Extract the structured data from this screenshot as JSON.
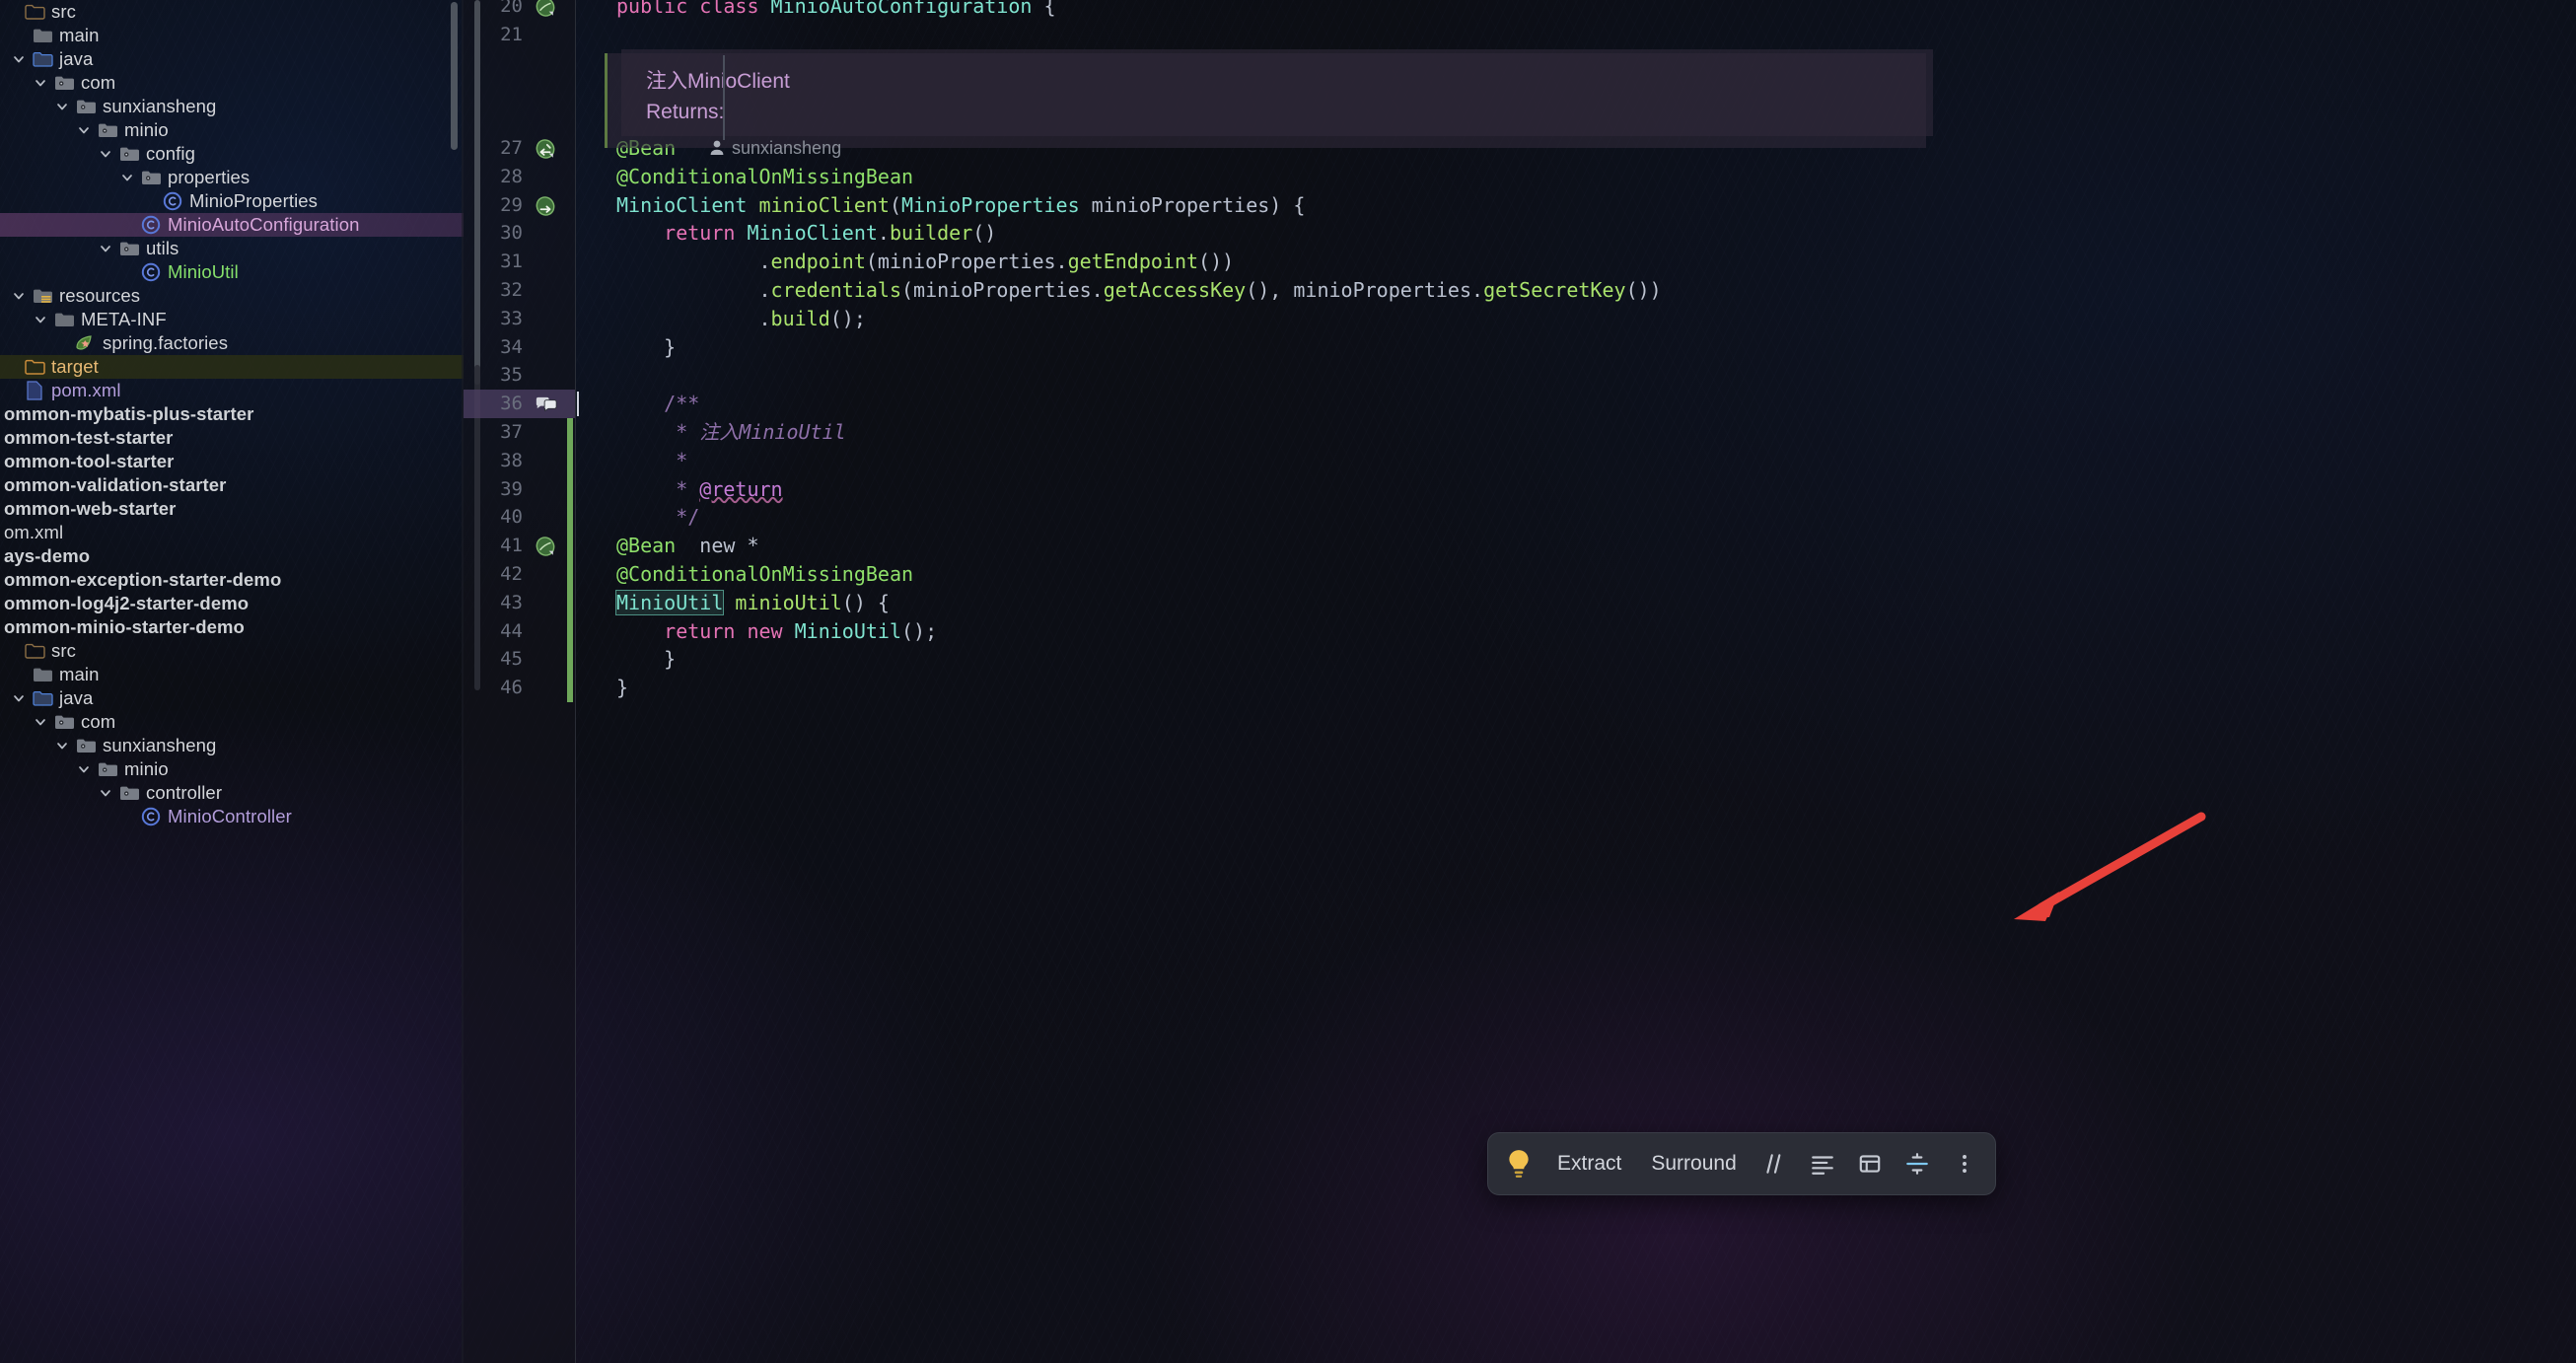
{
  "app": {
    "theme_bg": "#0d0f14",
    "accent_selection": "#5c3a66",
    "arrow_color": "#e8413a"
  },
  "sidebar": {
    "name": "project-tree",
    "items": [
      {
        "label": "src",
        "depth": 0,
        "icon": "folder-src",
        "chevron": "none",
        "style": "plain",
        "selected": false
      },
      {
        "label": "main",
        "depth": 1,
        "icon": "folder",
        "chevron": "none",
        "style": "plain",
        "selected": false
      },
      {
        "label": "java",
        "depth": 1,
        "icon": "folder-source",
        "chevron": "down",
        "style": "plain",
        "selected": false
      },
      {
        "label": "com",
        "depth": 2,
        "icon": "folder-package",
        "chevron": "down",
        "style": "plain",
        "selected": false
      },
      {
        "label": "sunxiansheng",
        "depth": 3,
        "icon": "folder-package",
        "chevron": "down",
        "style": "plain",
        "selected": false
      },
      {
        "label": "minio",
        "depth": 4,
        "icon": "folder-package",
        "chevron": "down",
        "style": "plain",
        "selected": false
      },
      {
        "label": "config",
        "depth": 5,
        "icon": "folder-package",
        "chevron": "down",
        "style": "plain",
        "selected": false
      },
      {
        "label": "properties",
        "depth": 6,
        "icon": "folder-package",
        "chevron": "down",
        "style": "plain",
        "selected": false
      },
      {
        "label": "MinioProperties",
        "depth": 7,
        "icon": "java-class",
        "chevron": "none",
        "style": "plain",
        "selected": false
      },
      {
        "label": "MinioAutoConfiguration",
        "depth": 6,
        "icon": "java-class",
        "chevron": "none",
        "style": "purple",
        "selected": true
      },
      {
        "label": "utils",
        "depth": 5,
        "icon": "folder-package",
        "chevron": "down",
        "style": "plain",
        "selected": false
      },
      {
        "label": "MinioUtil",
        "depth": 6,
        "icon": "java-class",
        "chevron": "none",
        "style": "green",
        "selected": false
      },
      {
        "label": "resources",
        "depth": 1,
        "icon": "folder-resource",
        "chevron": "down",
        "style": "plain",
        "selected": false
      },
      {
        "label": "META-INF",
        "depth": 2,
        "icon": "folder",
        "chevron": "down",
        "style": "plain",
        "selected": false
      },
      {
        "label": "spring.factories",
        "depth": 3,
        "icon": "spring-leaf",
        "chevron": "none",
        "style": "plain",
        "selected": false
      },
      {
        "label": "target",
        "depth": 0,
        "icon": "folder-excluded",
        "chevron": "none",
        "style": "orange",
        "selected": false,
        "highlight": "target"
      },
      {
        "label": "pom.xml",
        "depth": 0,
        "icon": "maven-file",
        "chevron": "none",
        "style": "lilac",
        "selected": false
      },
      {
        "label": "ommon-mybatis-plus-starter",
        "depth": 0,
        "icon": "none",
        "chevron": "none",
        "style": "bold",
        "selected": false
      },
      {
        "label": "ommon-test-starter",
        "depth": 0,
        "icon": "none",
        "chevron": "none",
        "style": "bold",
        "selected": false
      },
      {
        "label": "ommon-tool-starter",
        "depth": 0,
        "icon": "none",
        "chevron": "none",
        "style": "bold",
        "selected": false
      },
      {
        "label": "ommon-validation-starter",
        "depth": 0,
        "icon": "none",
        "chevron": "none",
        "style": "bold",
        "selected": false
      },
      {
        "label": "ommon-web-starter",
        "depth": 0,
        "icon": "none",
        "chevron": "none",
        "style": "bold",
        "selected": false
      },
      {
        "label": "om.xml",
        "depth": 0,
        "icon": "none",
        "chevron": "none",
        "style": "plain",
        "selected": false
      },
      {
        "label": "ays-demo",
        "depth": 0,
        "icon": "none",
        "chevron": "none",
        "style": "bold",
        "selected": false
      },
      {
        "label": "ommon-exception-starter-demo",
        "depth": 0,
        "icon": "none",
        "chevron": "none",
        "style": "bold",
        "selected": false
      },
      {
        "label": "ommon-log4j2-starter-demo",
        "depth": 0,
        "icon": "none",
        "chevron": "none",
        "style": "bold",
        "selected": false
      },
      {
        "label": "ommon-minio-starter-demo",
        "depth": 0,
        "icon": "none",
        "chevron": "none",
        "style": "bold",
        "selected": false
      },
      {
        "label": "src",
        "depth": 0,
        "icon": "folder-src",
        "chevron": "none",
        "style": "plain",
        "selected": false
      },
      {
        "label": "main",
        "depth": 1,
        "icon": "folder",
        "chevron": "none",
        "style": "plain",
        "selected": false
      },
      {
        "label": "java",
        "depth": 1,
        "icon": "folder-source",
        "chevron": "down",
        "style": "plain",
        "selected": false
      },
      {
        "label": "com",
        "depth": 2,
        "icon": "folder-package",
        "chevron": "down",
        "style": "plain",
        "selected": false
      },
      {
        "label": "sunxiansheng",
        "depth": 3,
        "icon": "folder-package",
        "chevron": "down",
        "style": "plain",
        "selected": false
      },
      {
        "label": "minio",
        "depth": 4,
        "icon": "folder-package",
        "chevron": "down",
        "style": "plain",
        "selected": false
      },
      {
        "label": "controller",
        "depth": 5,
        "icon": "folder-package",
        "chevron": "down",
        "style": "plain",
        "selected": false
      },
      {
        "label": "MinioController",
        "depth": 6,
        "icon": "java-class",
        "chevron": "none",
        "style": "lilac",
        "selected": false
      }
    ]
  },
  "editor": {
    "name": "code-editor",
    "file": "MinioAutoConfiguration",
    "javadoc_panel": {
      "line1": "注入MinioClient",
      "line2": "Returns:"
    },
    "inlay_author": "sunxiansheng",
    "lines": [
      {
        "num": "20",
        "gutter_icon": "bean-class",
        "tokens": [
          {
            "t": "public ",
            "c": "kw"
          },
          {
            "t": "class ",
            "c": "kw"
          },
          {
            "t": "MinioAutoConfiguration",
            "c": "ty"
          },
          {
            "t": " {",
            "c": "pl"
          }
        ]
      },
      {
        "num": "21",
        "gutter_icon": "",
        "tokens": []
      },
      {
        "num": "",
        "gutter_icon": "",
        "tokens": []
      },
      {
        "num": "",
        "gutter_icon": "",
        "tokens": []
      },
      {
        "num": "",
        "gutter_icon": "",
        "tokens": []
      },
      {
        "num": "27",
        "gutter_icon": "bean-arrow-left",
        "tokens": [
          {
            "t": "@Bean",
            "c": "an"
          }
        ]
      },
      {
        "num": "28",
        "gutter_icon": "",
        "tokens": [
          {
            "t": "@ConditionalOnMissingBean",
            "c": "an"
          }
        ]
      },
      {
        "num": "29",
        "gutter_icon": "bean-arrow-right",
        "tokens": [
          {
            "t": "MinioClient",
            "c": "ty"
          },
          {
            "t": " ",
            "c": "pl"
          },
          {
            "t": "minioClient",
            "c": "fn"
          },
          {
            "t": "(",
            "c": "pl"
          },
          {
            "t": "MinioProperties",
            "c": "ty"
          },
          {
            "t": " ",
            "c": "pl"
          },
          {
            "t": "minioProperties",
            "c": "pm"
          },
          {
            "t": ") {",
            "c": "pl"
          }
        ]
      },
      {
        "num": "30",
        "gutter_icon": "",
        "tokens": [
          {
            "t": "    ",
            "c": "pl"
          },
          {
            "t": "return ",
            "c": "kw"
          },
          {
            "t": "MinioClient",
            "c": "ty"
          },
          {
            "t": ".",
            "c": "pl"
          },
          {
            "t": "builder",
            "c": "fn"
          },
          {
            "t": "()",
            "c": "pl"
          }
        ]
      },
      {
        "num": "31",
        "gutter_icon": "",
        "tokens": [
          {
            "t": "            .",
            "c": "pl"
          },
          {
            "t": "endpoint",
            "c": "fn"
          },
          {
            "t": "(",
            "c": "pl"
          },
          {
            "t": "minioProperties",
            "c": "pm"
          },
          {
            "t": ".",
            "c": "pl"
          },
          {
            "t": "getEndpoint",
            "c": "fn"
          },
          {
            "t": "())",
            "c": "pl"
          }
        ]
      },
      {
        "num": "32",
        "gutter_icon": "",
        "tokens": [
          {
            "t": "            .",
            "c": "pl"
          },
          {
            "t": "credentials",
            "c": "fn"
          },
          {
            "t": "(",
            "c": "pl"
          },
          {
            "t": "minioProperties",
            "c": "pm"
          },
          {
            "t": ".",
            "c": "pl"
          },
          {
            "t": "getAccessKey",
            "c": "fn"
          },
          {
            "t": "(), ",
            "c": "pl"
          },
          {
            "t": "minioProperties",
            "c": "pm"
          },
          {
            "t": ".",
            "c": "pl"
          },
          {
            "t": "getSecretKey",
            "c": "fn"
          },
          {
            "t": "())",
            "c": "pl"
          }
        ]
      },
      {
        "num": "33",
        "gutter_icon": "",
        "tokens": [
          {
            "t": "            .",
            "c": "pl"
          },
          {
            "t": "build",
            "c": "fn"
          },
          {
            "t": "();",
            "c": "pl"
          }
        ]
      },
      {
        "num": "34",
        "gutter_icon": "",
        "tokens": [
          {
            "t": "    }",
            "c": "pl"
          }
        ]
      },
      {
        "num": "35",
        "gutter_icon": "",
        "tokens": []
      },
      {
        "num": "36",
        "gutter_icon": "comment-bubble",
        "tokens": [
          {
            "t": "    /**",
            "c": "cm"
          }
        ]
      },
      {
        "num": "37",
        "gutter_icon": "",
        "tokens": [
          {
            "t": "     * ",
            "c": "cm"
          },
          {
            "t": "注入MinioUtil",
            "c": "cmi"
          }
        ]
      },
      {
        "num": "38",
        "gutter_icon": "",
        "tokens": [
          {
            "t": "     *",
            "c": "cm"
          }
        ]
      },
      {
        "num": "39",
        "gutter_icon": "",
        "tokens": [
          {
            "t": "     * ",
            "c": "cm"
          },
          {
            "t": "@return",
            "c": "tag"
          }
        ]
      },
      {
        "num": "40",
        "gutter_icon": "",
        "tokens": [
          {
            "t": "     */",
            "c": "cm"
          }
        ]
      },
      {
        "num": "41",
        "gutter_icon": "bean-class",
        "tokens": [
          {
            "t": "@Bean",
            "c": "an"
          },
          {
            "t": "  new *",
            "c": "pl"
          }
        ]
      },
      {
        "num": "42",
        "gutter_icon": "",
        "tokens": [
          {
            "t": "@ConditionalOnMissingBean",
            "c": "an"
          }
        ]
      },
      {
        "num": "43",
        "gutter_icon": "",
        "tokens": [
          {
            "t": "MinioUtil",
            "c": "ty hlbox"
          },
          {
            "t": " ",
            "c": "pl"
          },
          {
            "t": "minioUtil",
            "c": "fn"
          },
          {
            "t": "() {",
            "c": "pl"
          }
        ]
      },
      {
        "num": "44",
        "gutter_icon": "",
        "tokens": [
          {
            "t": "    ",
            "c": "pl"
          },
          {
            "t": "return ",
            "c": "kw"
          },
          {
            "t": "new ",
            "c": "kw"
          },
          {
            "t": "MinioUtil",
            "c": "ty"
          },
          {
            "t": "();",
            "c": "pl"
          }
        ]
      },
      {
        "num": "45",
        "gutter_icon": "",
        "tokens": [
          {
            "t": "    }",
            "c": "pl"
          }
        ]
      },
      {
        "num": "46",
        "gutter_icon": "",
        "tokens": [
          {
            "t": "}",
            "c": "pl"
          }
        ]
      }
    ]
  },
  "toolbar": {
    "name": "intention-actions-toolbar",
    "bulb_icon": "lightbulb-icon",
    "extract_label": "Extract",
    "surround_label": "Surround",
    "comment_icon": "comment-slashes-icon",
    "reformat_icon": "reformat-lines-icon",
    "table_icon": "table-icon",
    "expand_icon": "expand-selection-icon",
    "more_icon": "more-vertical-icon"
  },
  "annotation": {
    "name": "red-arrow",
    "color": "#e8413a",
    "points_to": "MinioUtil minioUtil() { line 43"
  }
}
